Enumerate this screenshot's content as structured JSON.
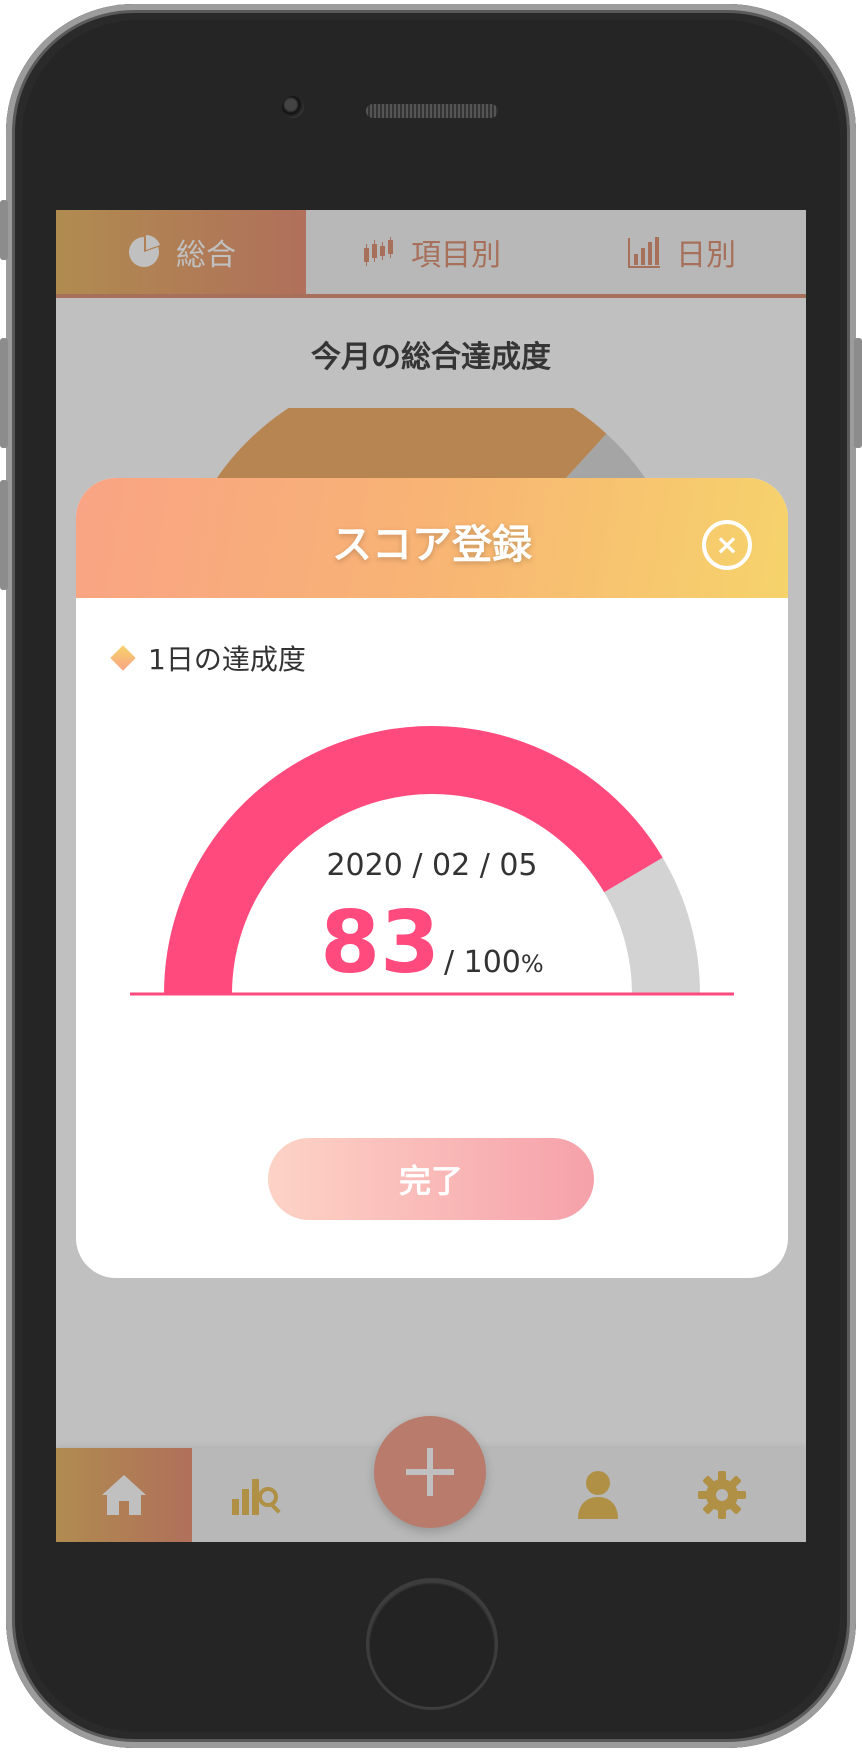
{
  "tabs": [
    {
      "label": "総合",
      "icon": "pie-chart-icon",
      "active": true
    },
    {
      "label": "項目別",
      "icon": "candlestick-chart-icon",
      "active": false
    },
    {
      "label": "日別",
      "icon": "bar-chart-icon",
      "active": false
    }
  ],
  "background": {
    "title": "今月の総合達成度"
  },
  "modal": {
    "title": "スコア登録",
    "section_label": "1日の達成度",
    "date": "2020 / 02 / 05",
    "score": "83",
    "score_max": "/ 100",
    "score_unit": "%",
    "score_fraction": 0.83,
    "done_label": "完了",
    "close_icon": "close-circle-icon"
  },
  "bottom_nav": {
    "items": [
      {
        "icon": "home-icon",
        "active": true
      },
      {
        "icon": "chart-search-icon",
        "active": false
      },
      {
        "icon": "plus-icon",
        "active": false
      },
      {
        "icon": "user-icon",
        "active": false
      },
      {
        "icon": "gear-icon",
        "active": false
      }
    ]
  },
  "colors": {
    "accent_pink": "#ff4a7d",
    "gauge_rest": "#d3d3d3",
    "tab_active_start": "#e8b25a",
    "tab_active_end": "#e8896a",
    "icon_gold": "#e6b84a"
  }
}
